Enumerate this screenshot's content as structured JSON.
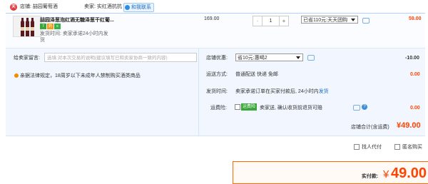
{
  "header": {
    "store_label": "店铺: 喆园葡萄酒",
    "seller_label": "卖家: 实红酒抗抗",
    "contact_label": "和我联系",
    "store_icon_text": "天"
  },
  "item": {
    "title": "喆园泽葱泡红酒无糖泽葱干红葡...",
    "badges": [
      "7",
      "药",
      "≡"
    ],
    "ship_time": "发货时间: 卖家承诺24小时内发货",
    "unit_price": "169.00",
    "quantity": "1",
    "qty_minus": "-",
    "qty_plus": "+",
    "promo": "已省110元:天天团购",
    "subtotal": "59.00"
  },
  "message": {
    "label": "给卖家留言:",
    "placeholder": "选填:对本次交易的说明(建议填写已和卖家协商一致的内容)"
  },
  "notice": "亲据法律规定，18周岁以下未成年人禁制购买酒类商品",
  "store_discount": {
    "label": "店铺优惠:",
    "selected": "省10元:惠喝2",
    "amount": "-10.00"
  },
  "shipping": {
    "label": "运送方式:",
    "value": "普通配送 快递 免邮",
    "amount": "0.00"
  },
  "delivery": {
    "label": "发货时间:",
    "value": "卖家承诺订单在买家付款后, 24小时内",
    "link": "发货"
  },
  "insurance": {
    "label": "运费险:",
    "tag": "运费险",
    "text": "卖家送, 确认收货前退货可赔",
    "help": "?",
    "amount": "0.00"
  },
  "store_total": {
    "label": "店铺合计(含运费)",
    "amount": "¥49.00"
  },
  "options": {
    "anonymous": "找人代付",
    "secret": "匿名购买"
  },
  "payment": {
    "label": "实付款:",
    "currency": "¥",
    "amount": "49.00"
  },
  "colors": {
    "price_red": "#ff4400",
    "link_blue": "#1a6fc0",
    "panel_bg": "#f2f7ff"
  }
}
